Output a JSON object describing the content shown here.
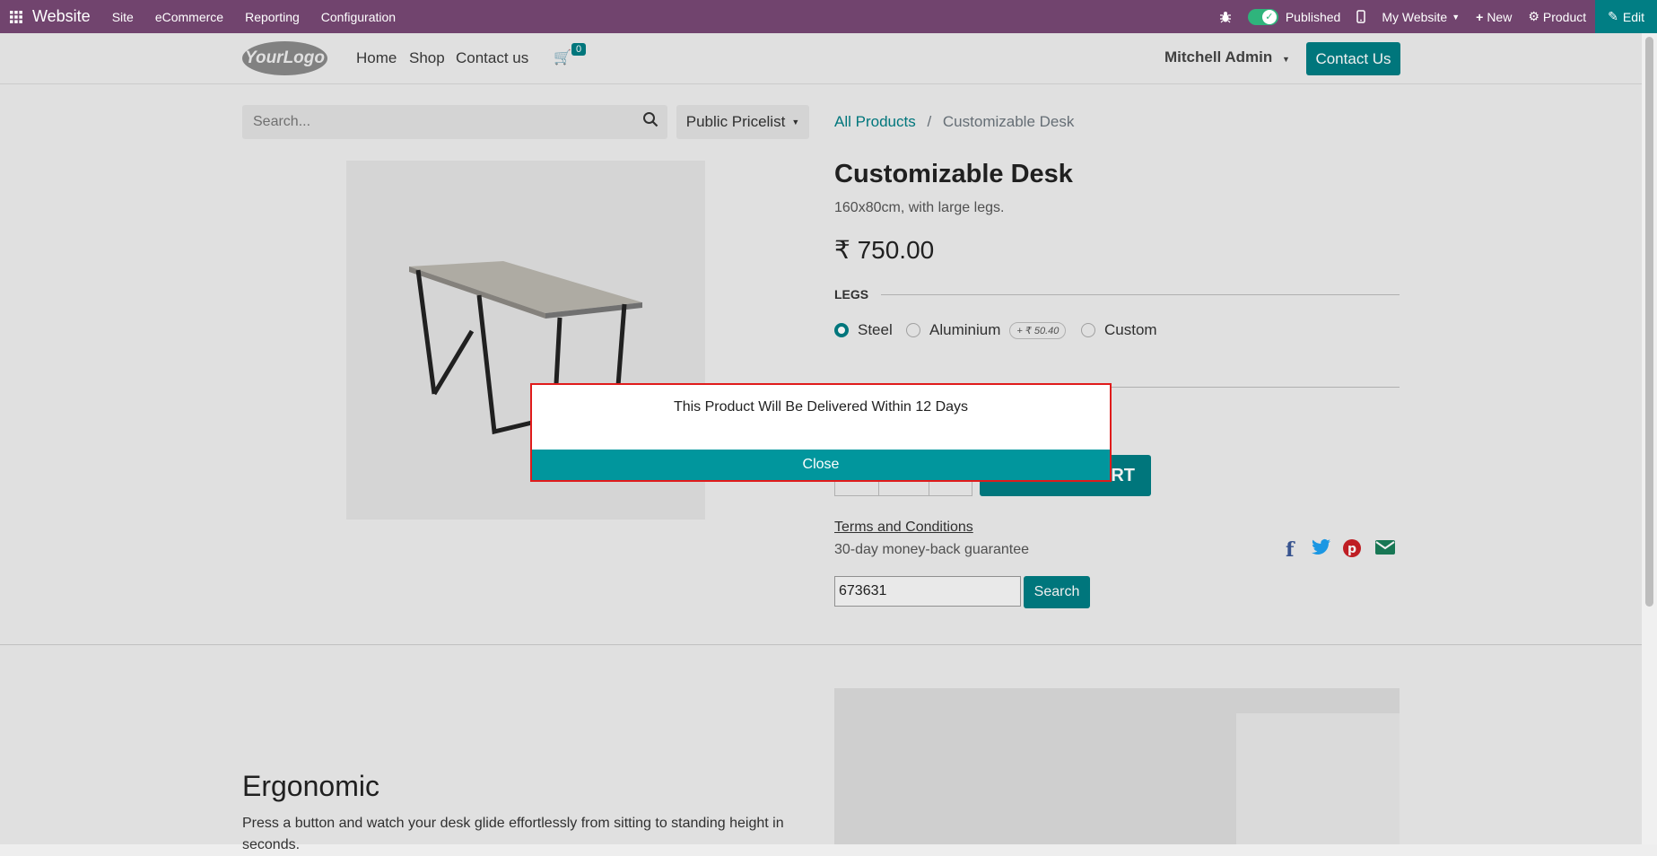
{
  "topbar": {
    "brand": "Website",
    "menus": [
      "Site",
      "eCommerce",
      "Reporting",
      "Configuration"
    ],
    "published_label": "Published",
    "website_label": "My Website",
    "new_label": "New",
    "product_label": "Product",
    "edit_label": "Edit"
  },
  "header": {
    "logo": "YourLogo",
    "nav": [
      "Home",
      "Shop",
      "Contact us"
    ],
    "cart_count": "0",
    "user": "Mitchell Admin",
    "contact_button": "Contact Us"
  },
  "search": {
    "placeholder": "Search...",
    "pricelist": "Public Pricelist"
  },
  "breadcrumb": {
    "all_products": "All Products",
    "separator": "/",
    "current": "Customizable Desk"
  },
  "product": {
    "name": "Customizable Desk",
    "description": "160x80cm, with large legs.",
    "price": "₹ 750.00",
    "legs_heading": "LEGS",
    "legs_options": [
      "Steel",
      "Aluminium",
      "Custom"
    ],
    "aluminium_extra": "+ ₹ 50.40",
    "add_to_cart_visible": "RT",
    "terms": "Terms and Conditions",
    "guarantee": "30-day money-back guarantee"
  },
  "code_search": {
    "value": "673631",
    "button": "Search"
  },
  "ergonomic": {
    "title": "Ergonomic",
    "text": "Press a button and watch your desk glide effortlessly from sitting to standing height in seconds."
  },
  "popup": {
    "message": "This Product Will Be Delivered Within 12 Days",
    "close_label": "Close",
    "border_color": "#e01b1b",
    "button_color": "#01969d"
  },
  "colors": {
    "topbar": "#71446e",
    "accent": "#017e84"
  }
}
